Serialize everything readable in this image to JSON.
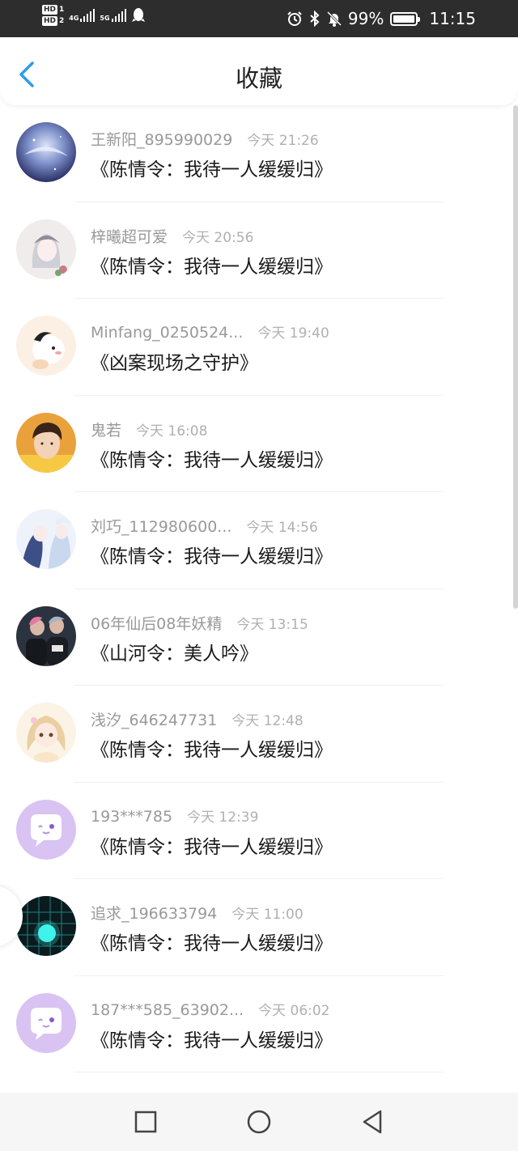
{
  "status_bar": {
    "hd1": "HD",
    "hd1_num": "1",
    "hd2": "HD",
    "hd2_num": "2",
    "net1": "4G",
    "net2": "5G",
    "battery_percent": "99%",
    "battery_level": 0.99,
    "time": "11:15",
    "icons": [
      "alarm-icon",
      "bluetooth-icon",
      "mute-icon",
      "battery-icon"
    ]
  },
  "header": {
    "title": "收藏",
    "back_icon": "chevron-left-icon"
  },
  "colors": {
    "accent": "#2b9bf0",
    "status_bar_bg": "#2d2d2d",
    "username": "#999999",
    "time": "#b0b0b0",
    "title_text": "#1a1a1a"
  },
  "items": [
    {
      "username": "王新阳_895990029",
      "time": "今天 21:26",
      "work": "《陈情令：我待一人缓缓归》"
    },
    {
      "username": "梓曦超可爱",
      "time": "今天 20:56",
      "work": "《陈情令：我待一人缓缓归》"
    },
    {
      "username": "Minfang_0250524...",
      "time": "今天 19:40",
      "work": "《凶案现场之守护》"
    },
    {
      "username": "鬼若",
      "time": "今天 16:08",
      "work": "《陈情令：我待一人缓缓归》"
    },
    {
      "username": "刘巧_112980600...",
      "time": "今天 14:56",
      "work": "《陈情令：我待一人缓缓归》"
    },
    {
      "username": "06年仙后08年妖精",
      "time": "今天 13:15",
      "work": "《山河令：美人吟》"
    },
    {
      "username": "浅汐_646247731",
      "time": "今天 12:48",
      "work": "《陈情令：我待一人缓缓归》"
    },
    {
      "username": "193***785",
      "time": "今天 12:39",
      "work": "《陈情令：我待一人缓缓归》"
    },
    {
      "username": "追求_196633794",
      "time": "今天 11:00",
      "work": "《陈情令：我待一人缓缓归》"
    },
    {
      "username": "187***585_63902...",
      "time": "今天 06:02",
      "work": "《陈情令：我待一人缓缓归》"
    }
  ],
  "bottom_nav": [
    "recents-square-icon",
    "home-circle-icon",
    "back-triangle-icon"
  ]
}
